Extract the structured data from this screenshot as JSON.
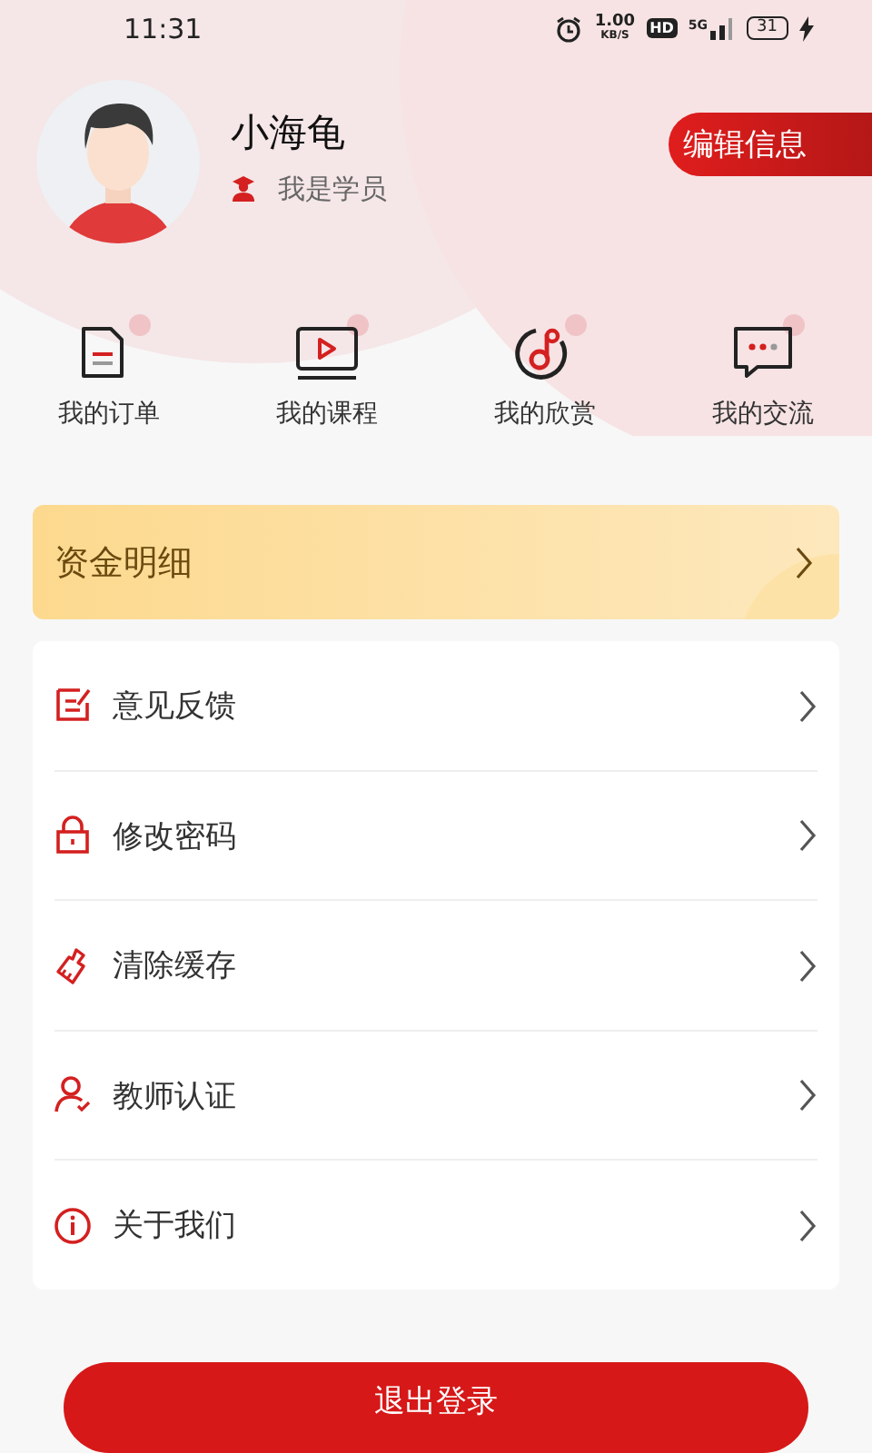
{
  "status_bar": {
    "time": "11:31",
    "net_speed": "1.00",
    "net_unit": "KB/S",
    "hd": "HD",
    "network": "5G",
    "battery": "31"
  },
  "profile": {
    "name": "小海龟",
    "role": "我是学员",
    "edit_button": "编辑信息"
  },
  "shortcuts": [
    {
      "label": "我的订单",
      "kind": "document"
    },
    {
      "label": "我的课程",
      "kind": "video"
    },
    {
      "label": "我的欣赏",
      "kind": "music"
    },
    {
      "label": "我的交流",
      "kind": "chat"
    }
  ],
  "fund_card": {
    "label": "资金明细"
  },
  "menu": [
    {
      "label": "意见反馈",
      "kind": "feedback"
    },
    {
      "label": "修改密码",
      "kind": "lock"
    },
    {
      "label": "清除缓存",
      "kind": "brush"
    },
    {
      "label": "教师认证",
      "kind": "teacher"
    },
    {
      "label": "关于我们",
      "kind": "info"
    }
  ],
  "logout_button": "退出登录"
}
